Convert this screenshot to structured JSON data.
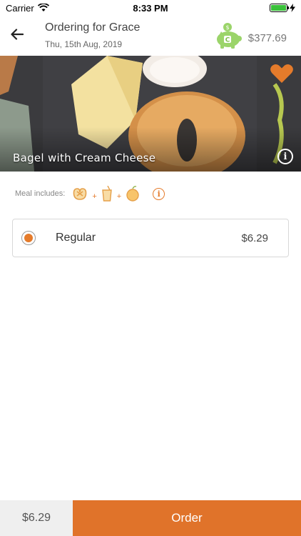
{
  "status_bar": {
    "carrier": "Carrier",
    "time": "8:33 PM"
  },
  "header": {
    "title": "Ordering for Grace",
    "date": "Thu, 15th Aug, 2019",
    "balance": "$377.69"
  },
  "product": {
    "name": "Bagel with Cream Cheese",
    "favorited": true
  },
  "meal": {
    "label": "Meal includes:",
    "items": [
      "pretzel-icon",
      "drink-icon",
      "fruit-icon"
    ],
    "plus": "+"
  },
  "option": {
    "name": "Regular",
    "price": "$6.29",
    "selected": true
  },
  "footer": {
    "total": "$6.29",
    "order_label": "Order"
  },
  "colors": {
    "accent": "#e0732a",
    "piggy": "#9bd46a",
    "green": "#3ac13a"
  }
}
